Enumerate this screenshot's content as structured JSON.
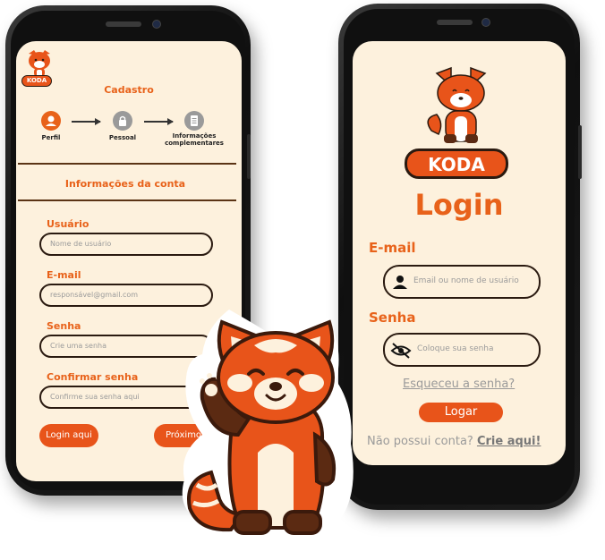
{
  "brand": {
    "name": "KODA"
  },
  "signup": {
    "title": "Cadastro",
    "steps": [
      {
        "label": "Perfil",
        "icon": "user-icon"
      },
      {
        "label": "Pessoal",
        "icon": "lock-icon"
      },
      {
        "label": "Informações complementares",
        "icon": "document-icon"
      }
    ],
    "section_title": "Informações da conta",
    "fields": [
      {
        "label": "Usuário",
        "placeholder": "Nome de usuário"
      },
      {
        "label": "E-mail",
        "placeholder": "responsável@gmail.com"
      },
      {
        "label": "Senha",
        "placeholder": "Crie uma senha"
      },
      {
        "label": "Confirmar senha",
        "placeholder": "Confirme sua senha aqui"
      }
    ],
    "login_button": "Login aqui",
    "next_button": "Próximo"
  },
  "login": {
    "title": "Login",
    "email_label": "E-mail",
    "email_placeholder": "Email ou nome de usuário",
    "password_label": "Senha",
    "password_placeholder": "Coloque sua senha",
    "forgot_link": "Esqueceu a senha?",
    "login_button": "Logar",
    "no_account_text": "Não possui conta?",
    "signup_link": "Crie aqui!"
  },
  "colors": {
    "accent": "#e8541a",
    "background": "#fdf1dd",
    "dark": "#2a1a10"
  }
}
